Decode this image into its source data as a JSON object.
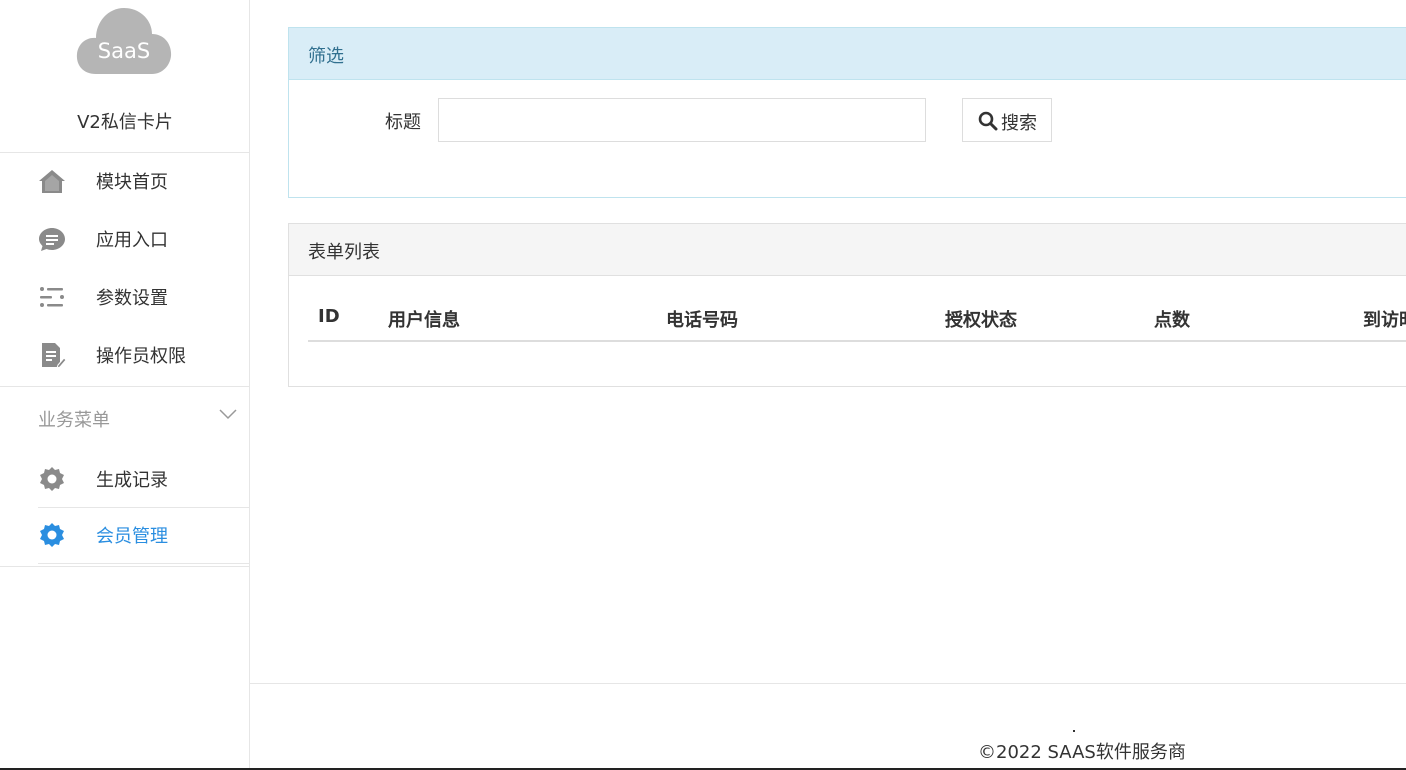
{
  "sidebar": {
    "logo_text": "SaaS",
    "app_title": "V2私信卡片",
    "items": [
      {
        "label": "模块首页",
        "icon": "home-icon"
      },
      {
        "label": "应用入口",
        "icon": "chat-bubble-icon"
      },
      {
        "label": "参数设置",
        "icon": "list-settings-icon"
      },
      {
        "label": "操作员权限",
        "icon": "document-edit-icon"
      }
    ],
    "group_title": "业务菜单",
    "group_items": [
      {
        "label": "生成记录",
        "icon": "gear-icon"
      },
      {
        "label": "会员管理",
        "icon": "gear-icon",
        "active": true
      }
    ]
  },
  "filter": {
    "heading": "筛选",
    "title_label": "标题",
    "title_value": "",
    "search_label": "搜索"
  },
  "list": {
    "heading": "表单列表",
    "columns": [
      "ID",
      "用户信息",
      "电话号码",
      "授权状态",
      "点数",
      "到访时"
    ]
  },
  "footer": {
    "copyright": "©2022 SAAS软件服务商"
  },
  "colors": {
    "accent": "#2a8ee0",
    "filter_header_bg": "#d9edf7",
    "filter_header_text": "#31708f",
    "icon_gray": "#8a8a8a",
    "logo_gray": "#b5b5b5"
  }
}
